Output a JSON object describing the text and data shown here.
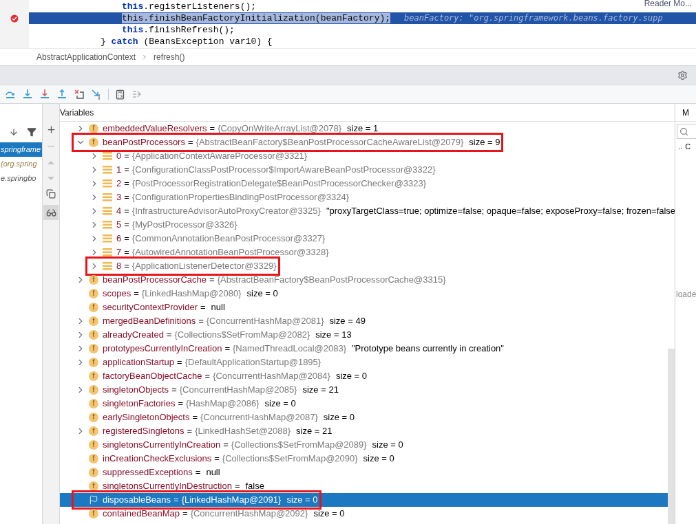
{
  "editor": {
    "lines": [
      {
        "kind": "inner",
        "selected": false,
        "breakpoint": false,
        "tokens": [
          {
            "kind": "keyword",
            "text": "this"
          },
          {
            "kind": "plain",
            "text": ".registerListeners();"
          }
        ]
      },
      {
        "kind": "inner",
        "selected": true,
        "breakpoint": true,
        "tokens": [
          {
            "kind": "selection",
            "text": "this.finishBeanFactoryInitialization(beanFactory);"
          },
          {
            "kind": "hint",
            "text": "beanFactory: \"org.springframework.beans.factory.supp"
          }
        ]
      },
      {
        "kind": "inner",
        "selected": false,
        "breakpoint": false,
        "tokens": [
          {
            "kind": "keyword",
            "text": "this"
          },
          {
            "kind": "plain",
            "text": ".finishRefresh();"
          }
        ]
      },
      {
        "kind": "outer",
        "selected": false,
        "breakpoint": false,
        "tokens": [
          {
            "kind": "plain",
            "text": "} "
          },
          {
            "kind": "keyword",
            "text": "catch"
          },
          {
            "kind": "plain",
            "text": " (BeansException var10) {"
          }
        ]
      }
    ],
    "reader_mode": "Reader Mo...",
    "breadcrumbs": [
      "AbstractApplicationContext",
      "refresh()"
    ]
  },
  "frames": [
    {
      "label": "springframe",
      "selected": true
    },
    {
      "label": "(org.spring",
      "selected": false
    },
    {
      "label": "e.springbo",
      "selected": false
    }
  ],
  "variables": {
    "title": "Variables",
    "rows": [
      {
        "kind": "field",
        "icon_text": "f",
        "expandable": true,
        "expanded": false,
        "selected": false,
        "highlighted": false,
        "name": "embeddedValueResolvers",
        "op": "=",
        "value": "{CopyOnWriteArrayList@2078}",
        "extra": "size = 1"
      },
      {
        "kind": "field",
        "icon_text": "f",
        "expandable": true,
        "expanded": true,
        "selected": false,
        "highlighted": true,
        "name": "beanPostProcessors",
        "op": "=",
        "value": "{AbstractBeanFactory$BeanPostProcessorCacheAwareList@2079}",
        "extra": "size = 9",
        "children": [
          {
            "kind": "item",
            "expandable": true,
            "expanded": false,
            "selected": false,
            "highlighted": false,
            "name": "0",
            "op": "=",
            "value": "{ApplicationContextAwareProcessor@3321}"
          },
          {
            "kind": "item",
            "expandable": true,
            "expanded": false,
            "selected": false,
            "highlighted": false,
            "name": "1",
            "op": "=",
            "value": "{ConfigurationClassPostProcessor$ImportAwareBeanPostProcessor@3322}"
          },
          {
            "kind": "item",
            "expandable": true,
            "expanded": false,
            "selected": false,
            "highlighted": false,
            "name": "2",
            "op": "=",
            "value": "{PostProcessorRegistrationDelegate$BeanPostProcessorChecker@3323}"
          },
          {
            "kind": "item",
            "expandable": true,
            "expanded": false,
            "selected": false,
            "highlighted": false,
            "name": "3",
            "op": "=",
            "value": "{ConfigurationPropertiesBindingPostProcessor@3324}"
          },
          {
            "kind": "item",
            "expandable": true,
            "expanded": false,
            "selected": false,
            "highlighted": false,
            "name": "4",
            "op": "=",
            "value": "{InfrastructureAdvisorAutoProxyCreator@3325}",
            "extra": "\"proxyTargetClass=true; optimize=false; opaque=false; exposeProxy=false; frozen=false"
          },
          {
            "kind": "item",
            "expandable": true,
            "expanded": false,
            "selected": false,
            "highlighted": false,
            "name": "5",
            "op": "=",
            "value": "{MyPostProcessor@3326}"
          },
          {
            "kind": "item",
            "expandable": true,
            "expanded": false,
            "selected": false,
            "highlighted": false,
            "name": "6",
            "op": "=",
            "value": "{CommonAnnotationBeanPostProcessor@3327}"
          },
          {
            "kind": "item",
            "expandable": true,
            "expanded": false,
            "selected": false,
            "highlighted": false,
            "name": "7",
            "op": "=",
            "value": "{AutowiredAnnotationBeanPostProcessor@3328}"
          },
          {
            "kind": "item",
            "expandable": true,
            "expanded": false,
            "selected": false,
            "highlighted": true,
            "name": "8",
            "op": "=",
            "value": "{ApplicationListenerDetector@3329}"
          }
        ]
      },
      {
        "kind": "field",
        "icon_text": "f",
        "expandable": true,
        "expanded": false,
        "selected": false,
        "highlighted": false,
        "name": "beanPostProcessorCache",
        "op": "=",
        "value": "{AbstractBeanFactory$BeanPostProcessorCache@3315}"
      },
      {
        "kind": "field",
        "icon_text": "f",
        "expandable": false,
        "selected": false,
        "highlighted": false,
        "name": "scopes",
        "op": "=",
        "value": "{LinkedHashMap@2080}",
        "extra": "size = 0"
      },
      {
        "kind": "field",
        "icon_text": "f",
        "expandable": false,
        "selected": false,
        "highlighted": false,
        "name": "securityContextProvider",
        "op": "=",
        "extra": "null"
      },
      {
        "kind": "field",
        "icon_text": "f",
        "expandable": true,
        "expanded": false,
        "selected": false,
        "highlighted": false,
        "name": "mergedBeanDefinitions",
        "op": "=",
        "value": "{ConcurrentHashMap@2081}",
        "extra": "size = 49"
      },
      {
        "kind": "field",
        "icon_text": "f",
        "expandable": true,
        "expanded": false,
        "selected": false,
        "highlighted": false,
        "name": "alreadyCreated",
        "op": "=",
        "value": "{Collections$SetFromMap@2082}",
        "extra": "size = 13"
      },
      {
        "kind": "field",
        "icon_text": "f",
        "expandable": true,
        "expanded": false,
        "selected": false,
        "highlighted": false,
        "name": "prototypesCurrentlyInCreation",
        "op": "=",
        "value": "{NamedThreadLocal@2083}",
        "extra": "\"Prototype beans currently in creation\""
      },
      {
        "kind": "field",
        "icon_text": "f",
        "expandable": true,
        "expanded": false,
        "selected": false,
        "highlighted": false,
        "name": "applicationStartup",
        "op": "=",
        "value": "{DefaultApplicationStartup@1895}"
      },
      {
        "kind": "field",
        "icon_text": "f",
        "expandable": false,
        "selected": false,
        "highlighted": false,
        "name": "factoryBeanObjectCache",
        "op": "=",
        "value": "{ConcurrentHashMap@2084}",
        "extra": "size = 0"
      },
      {
        "kind": "field",
        "icon_text": "f",
        "expandable": true,
        "expanded": false,
        "selected": false,
        "highlighted": false,
        "name": "singletonObjects",
        "op": "=",
        "value": "{ConcurrentHashMap@2085}",
        "extra": "size = 21"
      },
      {
        "kind": "field",
        "icon_text": "f",
        "expandable": false,
        "selected": false,
        "highlighted": false,
        "name": "singletonFactories",
        "op": "=",
        "value": "{HashMap@2086}",
        "extra": "size = 0"
      },
      {
        "kind": "field",
        "icon_text": "f",
        "expandable": false,
        "selected": false,
        "highlighted": false,
        "name": "earlySingletonObjects",
        "op": "=",
        "value": "{ConcurrentHashMap@2087}",
        "extra": "size = 0"
      },
      {
        "kind": "field",
        "icon_text": "f",
        "expandable": true,
        "expanded": false,
        "selected": false,
        "highlighted": false,
        "name": "registeredSingletons",
        "op": "=",
        "value": "{LinkedHashSet@2088}",
        "extra": "size = 21"
      },
      {
        "kind": "field",
        "icon_text": "f",
        "expandable": false,
        "selected": false,
        "highlighted": false,
        "name": "singletonsCurrentlyInCreation",
        "op": "=",
        "value": "{Collections$SetFromMap@2089}",
        "extra": "size = 0"
      },
      {
        "kind": "field",
        "icon_text": "f",
        "expandable": false,
        "selected": false,
        "highlighted": false,
        "name": "inCreationCheckExclusions",
        "op": "=",
        "value": "{Collections$SetFromMap@2090}",
        "extra": "size = 0"
      },
      {
        "kind": "field",
        "icon_text": "f",
        "expandable": false,
        "selected": false,
        "highlighted": false,
        "name": "suppressedExceptions",
        "op": "=",
        "extra": "null"
      },
      {
        "kind": "field",
        "icon_text": "f",
        "expandable": false,
        "selected": false,
        "highlighted": false,
        "name": "singletonsCurrentlyInDestruction",
        "op": "=",
        "extra": "false"
      },
      {
        "kind": "flag",
        "expandable": false,
        "selected": true,
        "highlighted": true,
        "name": "disposableBeans",
        "op": "=",
        "value": "{LinkedHashMap@2091}",
        "extra": "size = 0"
      },
      {
        "kind": "field",
        "icon_text": "f",
        "expandable": false,
        "selected": false,
        "highlighted": false,
        "name": "containedBeanMap",
        "op": "=",
        "value": "{ConcurrentHashMap@2092}",
        "extra": "size = 0"
      }
    ]
  },
  "side_panel": {
    "tab": "M",
    "cells": [
      "..",
      "C"
    ],
    "note": "loade"
  }
}
